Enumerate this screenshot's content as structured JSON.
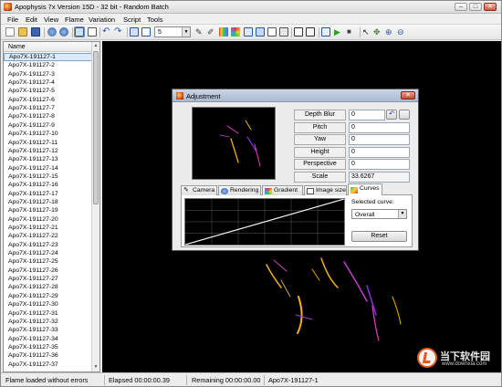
{
  "window": {
    "title": "Apophysis 7x Version 15D  - 32 bit - Random Batch",
    "minimize_glyph": "–",
    "restore_glyph": "□",
    "close_glyph": "✕"
  },
  "menu": [
    "File",
    "Edit",
    "View",
    "Flame",
    "Variation",
    "Script",
    "Tools"
  ],
  "toolbar": {
    "preview_density_value": "5",
    "icons": [
      "new-icon",
      "open-icon",
      "save-icon",
      "random-icon",
      "options-icon",
      "view-list-icon",
      "view-icons-icon",
      "undo-icon",
      "redo-icon",
      "full-preview-icon",
      "small-preview-icon",
      "editor-icon",
      "adjust-icon",
      "gradient-icon",
      "mutate-icon",
      "render-icon",
      "batch-render-icon",
      "image-size-icon",
      "flatten-icon",
      "transparency-icon",
      "script-icon",
      "run-icon",
      "stop-icon",
      "select-icon",
      "drag-icon",
      "zoom-in-icon",
      "zoom-out-icon"
    ]
  },
  "flame_list": {
    "header": "Name",
    "selected_index": 0,
    "items": [
      "Apo7X-191127-1",
      "Apo7X-191127-2",
      "Apo7X-191127-3",
      "Apo7X-191127-4",
      "Apo7X-191127-5",
      "Apo7X-191127-6",
      "Apo7X-191127-7",
      "Apo7X-191127-8",
      "Apo7X-191127-9",
      "Apo7X-191127-10",
      "Apo7X-191127-11",
      "Apo7X-191127-12",
      "Apo7X-191127-13",
      "Apo7X-191127-14",
      "Apo7X-191127-15",
      "Apo7X-191127-16",
      "Apo7X-191127-17",
      "Apo7X-191127-18",
      "Apo7X-191127-19",
      "Apo7X-191127-20",
      "Apo7X-191127-21",
      "Apo7X-191127-22",
      "Apo7X-191127-23",
      "Apo7X-191127-24",
      "Apo7X-191127-25",
      "Apo7X-191127-26",
      "Apo7X-191127-27",
      "Apo7X-191127-28",
      "Apo7X-191127-29",
      "Apo7X-191127-30",
      "Apo7X-191127-31",
      "Apo7X-191127-32",
      "Apo7X-191127-33",
      "Apo7X-191127-34",
      "Apo7X-191127-35",
      "Apo7X-191127-36",
      "Apo7X-191127-37"
    ]
  },
  "status": {
    "message": "Flame loaded without errors",
    "elapsed": "Elapsed 00:00:00.39",
    "remaining": "Remaining 00:00:00.00",
    "current_flame": "Apo7X-191127-1"
  },
  "adjustment": {
    "title": "Adjustment",
    "params": [
      {
        "label": "Depth Blur",
        "value": "0"
      },
      {
        "label": "Pitch",
        "value": "0"
      },
      {
        "label": "Yaw",
        "value": "0"
      },
      {
        "label": "Height",
        "value": "0"
      },
      {
        "label": "Perspective",
        "value": "0"
      },
      {
        "label": "Scale",
        "value": "33.6267"
      }
    ],
    "tabs": [
      "Camera",
      "Rendering",
      "Gradient",
      "Image size",
      "Curves"
    ],
    "active_tab": "Curves",
    "selected_curve_label": "Selected curve:",
    "selected_curve_value": "Overall",
    "reset_label": "Reset"
  },
  "watermark": {
    "text": "当下软件园",
    "url": "www.downxia.com"
  },
  "colors": {
    "flame_pink": "#e040c0",
    "flame_purple": "#8a2be2",
    "flame_gold": "#f5b400",
    "dialog_title": "#aabad2",
    "selection": "#dcebfc"
  }
}
